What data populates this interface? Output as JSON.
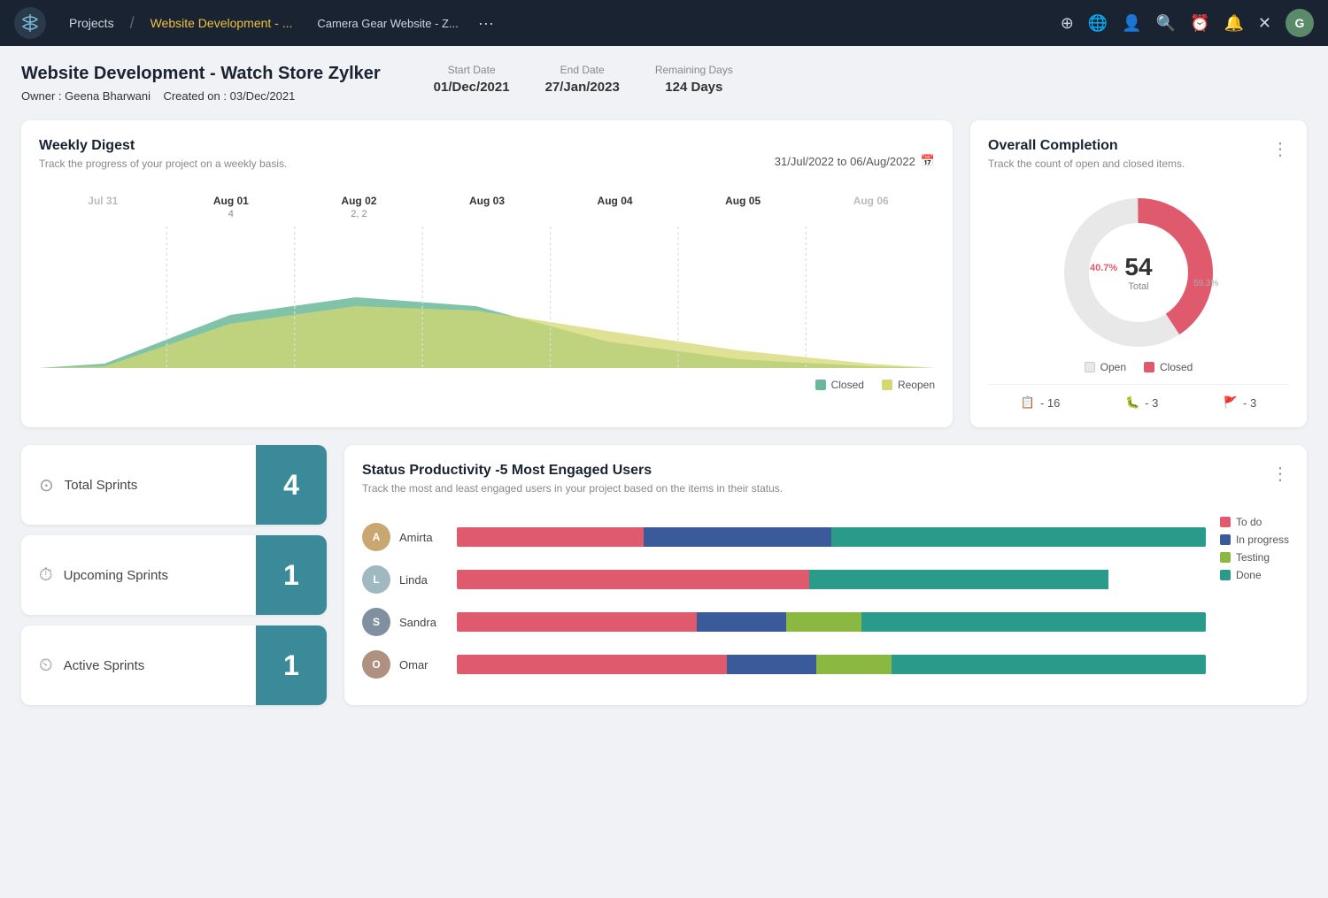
{
  "nav": {
    "logo_text": "✂",
    "projects_label": "Projects",
    "active_tab": "Website Development - ...",
    "current_page": "Camera Gear Website - Z...",
    "dots": "···",
    "icons": [
      "⊕",
      "🌐",
      "👤",
      "🔍",
      "⏰",
      "🔔",
      "✕"
    ]
  },
  "project": {
    "title": "Website Development - Watch Store Zylker",
    "owner_label": "Owner :",
    "owner": "Geena Bharwani",
    "created_label": "Created on :",
    "created": "03/Dec/2021",
    "start_date_label": "Start Date",
    "start_date": "01/Dec/2021",
    "end_date_label": "End Date",
    "end_date": "27/Jan/2023",
    "remaining_label": "Remaining Days",
    "remaining": "124 Days"
  },
  "weekly_digest": {
    "title": "Weekly Digest",
    "subtitle": "Track the progress of your project on a weekly basis.",
    "date_range": "31/Jul/2022  to  06/Aug/2022",
    "labels": [
      "Jul 31",
      "Aug 01",
      "Aug 02",
      "Aug 03",
      "Aug 04",
      "Aug 05",
      "Aug 06"
    ],
    "sublabels": [
      "",
      "4",
      "2, 2",
      "",
      "",
      "",
      ""
    ],
    "legend_closed": "Closed",
    "legend_reopen": "Reopen"
  },
  "overall_completion": {
    "title": "Overall Completion",
    "subtitle": "Track the count of open and closed items.",
    "total": "54",
    "total_label": "Total",
    "open_pct": "59.3%",
    "closed_pct": "40.7%",
    "legend_open": "Open",
    "legend_closed": "Closed",
    "stat1_icon": "📋",
    "stat1_value": "- 16",
    "stat2_icon": "🐛",
    "stat2_value": "- 3",
    "stat3_icon": "🚩",
    "stat3_value": "- 3"
  },
  "sprints": [
    {
      "label": "Total Sprints",
      "count": "4"
    },
    {
      "label": "Upcoming Sprints",
      "count": "1"
    },
    {
      "label": "Active Sprints",
      "count": "1"
    }
  ],
  "status_productivity": {
    "title": "Status Productivity -5 Most Engaged Users",
    "subtitle": "Track the most and least engaged users in your project based on the items in their status.",
    "users": [
      {
        "name": "Amirta",
        "bars": [
          {
            "label": "To do",
            "pct": 25,
            "color": "#e05a6d"
          },
          {
            "label": "In progress",
            "pct": 25,
            "color": "#3a5a9a"
          },
          {
            "label": "Done",
            "pct": 50,
            "color": "#2a9a8a"
          }
        ]
      },
      {
        "name": "Linda",
        "bars": [
          {
            "label": "To do",
            "pct": 47,
            "color": "#e05a6d"
          },
          {
            "label": "Done",
            "pct": 40,
            "color": "#2a9a8a"
          }
        ]
      },
      {
        "name": "Sandra",
        "bars": [
          {
            "label": "To do",
            "pct": 32,
            "color": "#e05a6d"
          },
          {
            "label": "In progress",
            "pct": 12,
            "color": "#3a5a9a"
          },
          {
            "label": "Testing",
            "pct": 10,
            "color": "#8ab840"
          },
          {
            "label": "Done",
            "pct": 46,
            "color": "#2a9a8a"
          }
        ]
      },
      {
        "name": "Omar",
        "bars": [
          {
            "label": "To do",
            "pct": 36,
            "color": "#e05a6d"
          },
          {
            "label": "In progress",
            "pct": 12,
            "color": "#3a5a9a"
          },
          {
            "label": "Testing",
            "pct": 10,
            "color": "#8ab840"
          },
          {
            "label": "Done",
            "pct": 42,
            "color": "#2a9a8a"
          }
        ]
      }
    ],
    "legend": [
      {
        "label": "To do",
        "color": "#e05a6d"
      },
      {
        "label": "In progress",
        "color": "#3a5a9a"
      },
      {
        "label": "Testing",
        "color": "#8ab840"
      },
      {
        "label": "Done",
        "color": "#2a9a8a"
      }
    ]
  },
  "colors": {
    "accent": "#3a8a9a",
    "nav_bg": "#1a2332",
    "open_color": "#e8e8e8",
    "closed_color": "#e05a6d"
  }
}
